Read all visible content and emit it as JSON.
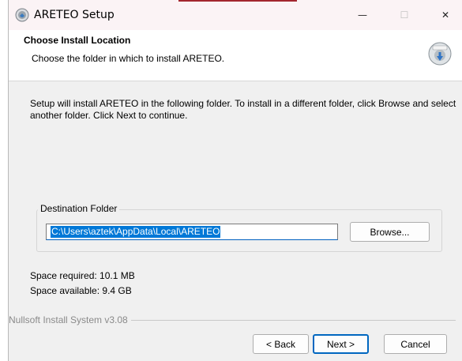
{
  "window": {
    "title": "ARETEO Setup",
    "minimize_glyph": "—",
    "maximize_glyph": "☐",
    "close_glyph": "✕"
  },
  "header": {
    "title": "Choose Install Location",
    "subtitle": "Choose the folder in which to install ARETEO."
  },
  "body": {
    "intro": "Setup will install ARETEO in the following folder. To install in a different folder, click Browse and select another folder. Click Next to continue.",
    "destination_group_label": "Destination Folder",
    "destination_path": "C:\\Users\\aztek\\AppData\\Local\\ARETEO",
    "browse_label": "Browse...",
    "space_required": "Space required: 10.1 MB",
    "space_available": "Space available: 9.4 GB"
  },
  "footer": {
    "branding": "Nullsoft Install System v3.08",
    "back_label": "< Back",
    "next_label": "Next >",
    "cancel_label": "Cancel"
  },
  "colors": {
    "accent": "#0078d7",
    "title_bar": "#fbf3f5",
    "dialog_bg": "#f0f0f0"
  }
}
